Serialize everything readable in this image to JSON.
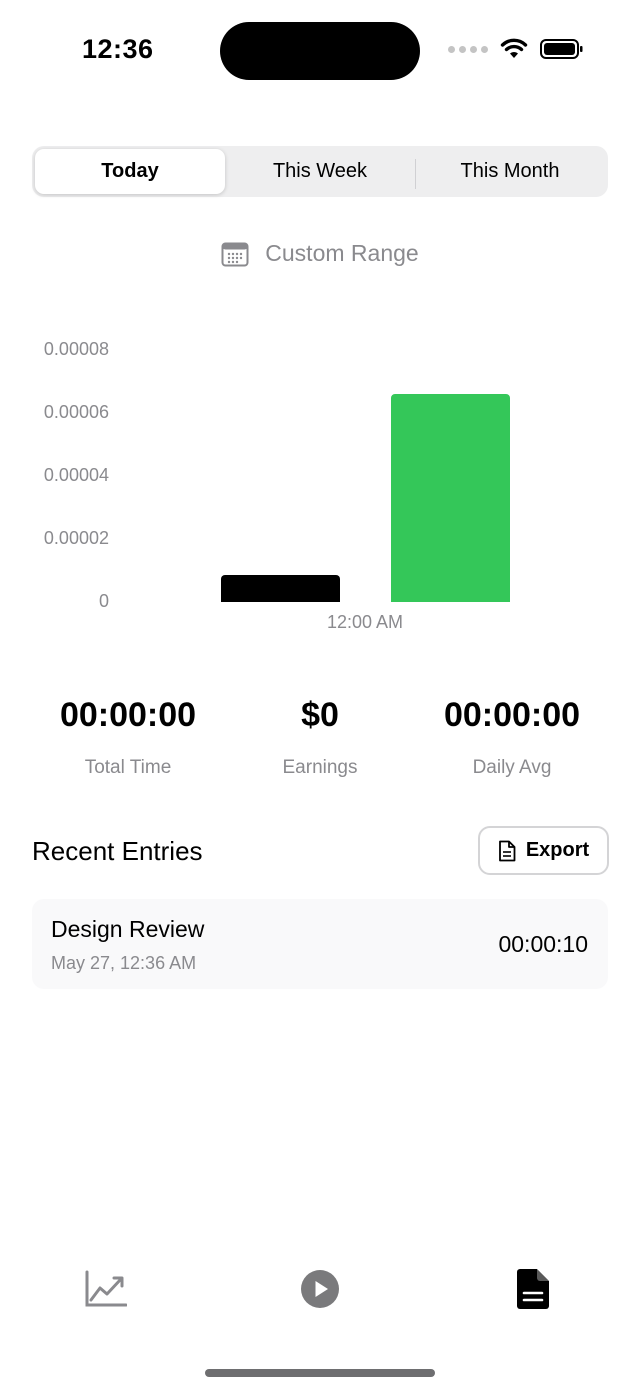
{
  "status_bar": {
    "time": "12:36"
  },
  "range_tabs": [
    {
      "label": "Today",
      "active": true
    },
    {
      "label": "This Week",
      "active": false
    },
    {
      "label": "This Month",
      "active": false
    }
  ],
  "custom_range": {
    "label": "Custom Range",
    "icon": "calendar-icon"
  },
  "chart_data": {
    "type": "bar",
    "categories": [
      "12:00 AM"
    ],
    "series": [
      {
        "values": [
          8.5e-06
        ],
        "color": "#000000"
      },
      {
        "values": [
          6.6e-05
        ],
        "color": "#34c759"
      }
    ],
    "ylim": [
      0,
      8e-05
    ],
    "y_ticks": [
      "0.00008",
      "0.00006",
      "0.00004",
      "0.00002",
      "0"
    ],
    "x_ticks": [
      "12:00 AM"
    ],
    "grid": false
  },
  "stats": [
    {
      "value": "00:00:00",
      "label": "Total Time"
    },
    {
      "value": "$0",
      "label": "Earnings"
    },
    {
      "value": "00:00:00",
      "label": "Daily Avg"
    }
  ],
  "recent": {
    "title": "Recent Entries",
    "export_label": "Export",
    "entries": [
      {
        "title": "Design Review",
        "date": "May 27, 12:36 AM",
        "duration": "00:00:10"
      }
    ]
  },
  "tab_bar": {
    "items": [
      {
        "icon": "chart-line-icon",
        "active": false
      },
      {
        "icon": "play-circle-icon",
        "active": false
      },
      {
        "icon": "document-icon",
        "active": true
      }
    ]
  },
  "colors": {
    "accent_green": "#34c759",
    "secondary_text": "#8a8a8e"
  }
}
